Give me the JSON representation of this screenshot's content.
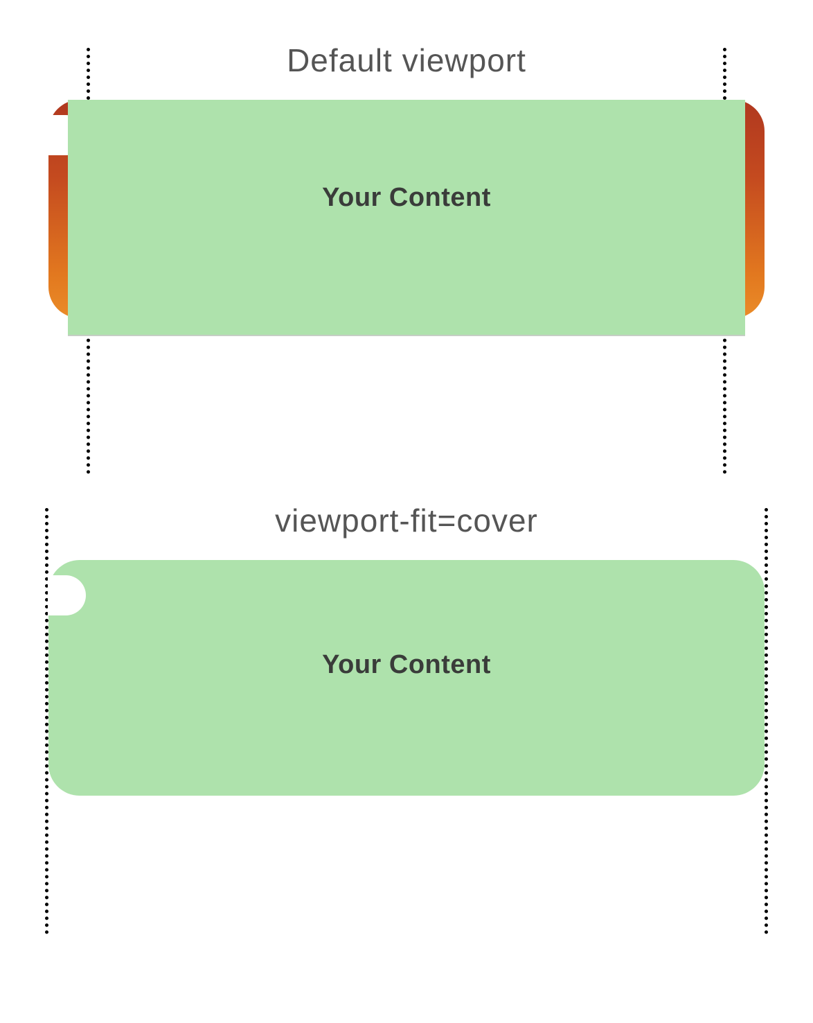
{
  "sections": [
    {
      "title": "Default viewport",
      "content_label": "Your Content"
    },
    {
      "title": "viewport-fit=cover",
      "content_label": "Your Content"
    }
  ]
}
